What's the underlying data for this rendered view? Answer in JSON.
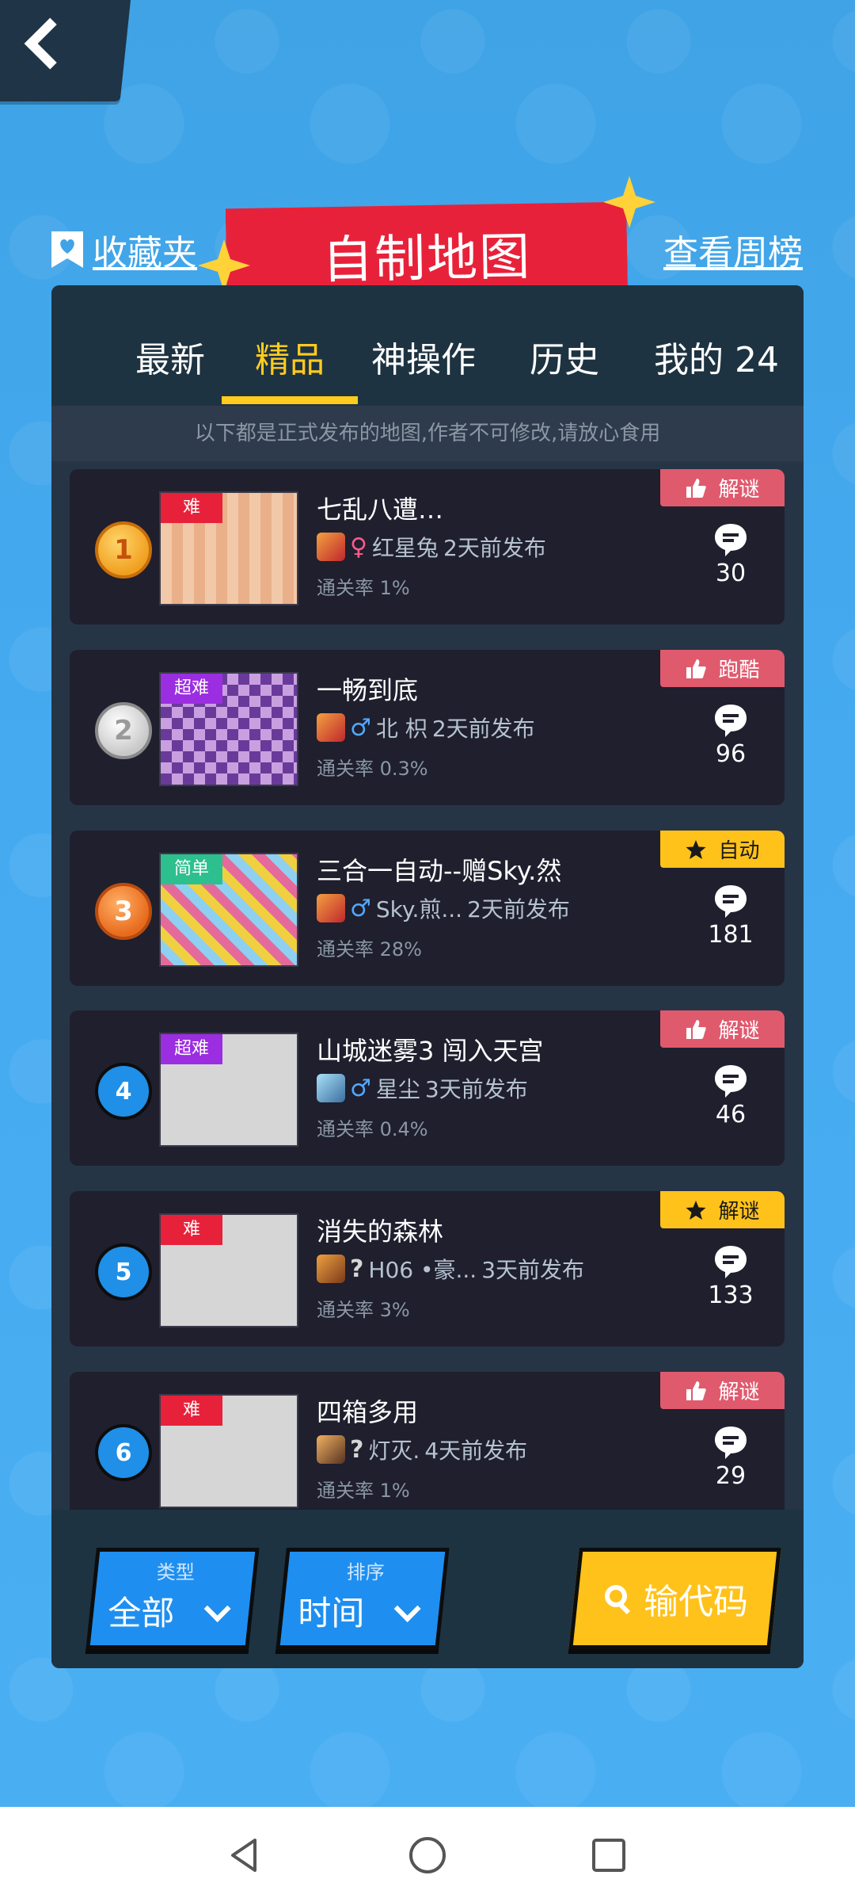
{
  "header": {
    "favorites_label": "收藏夹",
    "title": "自制地图",
    "weekly_label": "查看周榜"
  },
  "tabs": [
    {
      "label": "最新",
      "active": false
    },
    {
      "label": "精品",
      "active": true
    },
    {
      "label": "神操作",
      "active": false
    },
    {
      "label": "历史",
      "active": false
    },
    {
      "label": "我的 24",
      "active": false
    }
  ],
  "notice": "以下都是正式发布的地图,作者不可修改,请放心食用",
  "maps": [
    {
      "rank": "1",
      "rank_style": "gold",
      "difficulty": "难",
      "difficulty_style": "hard",
      "title": "七乱八遭…",
      "gender_symbol": "♀",
      "gender_style": "f",
      "author": "红星兔",
      "published": "2天前发布",
      "pass_rate": "通关率 1%",
      "tag": "解谜",
      "tag_style": "red",
      "tag_icon": "thumbs-up-icon",
      "comments": "30",
      "thumb": "pat1"
    },
    {
      "rank": "2",
      "rank_style": "silver",
      "difficulty": "超难",
      "difficulty_style": "super",
      "title": "一畅到底",
      "gender_symbol": "♂",
      "gender_style": "m",
      "author": "北 枳",
      "published": "2天前发布",
      "pass_rate": "通关率 0.3%",
      "tag": "跑酷",
      "tag_style": "red",
      "tag_icon": "thumbs-up-icon",
      "comments": "96",
      "thumb": "pat2"
    },
    {
      "rank": "3",
      "rank_style": "bronze",
      "difficulty": "简单",
      "difficulty_style": "easy",
      "title": "三合一自动--赠Sky.然",
      "gender_symbol": "♂",
      "gender_style": "m",
      "author": "Sky.煎...",
      "published": "2天前发布",
      "pass_rate": "通关率 28%",
      "tag": "自动",
      "tag_style": "yellow",
      "tag_icon": "star-icon",
      "comments": "181",
      "thumb": "pat3"
    },
    {
      "rank": "4",
      "rank_style": "blue",
      "difficulty": "超难",
      "difficulty_style": "super",
      "title": "山城迷雾3 闯入天宫",
      "gender_symbol": "♂",
      "gender_style": "m",
      "author": "星尘",
      "published": "3天前发布",
      "pass_rate": "通关率 0.4%",
      "tag": "解谜",
      "tag_style": "red",
      "tag_icon": "thumbs-up-icon",
      "comments": "46",
      "thumb": "blank"
    },
    {
      "rank": "5",
      "rank_style": "blue",
      "difficulty": "难",
      "difficulty_style": "hard",
      "title": "消失的森林",
      "gender_symbol": "?",
      "gender_style": "u",
      "author": "H06 •豪...",
      "published": "3天前发布",
      "pass_rate": "通关率 3%",
      "tag": "解谜",
      "tag_style": "yellow",
      "tag_icon": "star-icon",
      "comments": "133",
      "thumb": "blank"
    },
    {
      "rank": "6",
      "rank_style": "blue",
      "difficulty": "难",
      "difficulty_style": "hard",
      "title": "四箱多用",
      "gender_symbol": "?",
      "gender_style": "u",
      "author": "灯灭.",
      "published": "4天前发布",
      "pass_rate": "通关率 1%",
      "tag": "解谜",
      "tag_style": "red",
      "tag_icon": "thumbs-up-icon",
      "comments": "29",
      "thumb": "blank"
    }
  ],
  "filters": {
    "type_label": "类型",
    "type_value": "全部",
    "sort_label": "排序",
    "sort_value": "时间",
    "code_label": "输代码"
  },
  "colors": {
    "accent_yellow": "#ffcb1e",
    "banner_red": "#e8213a",
    "panel_dark": "#263545"
  }
}
